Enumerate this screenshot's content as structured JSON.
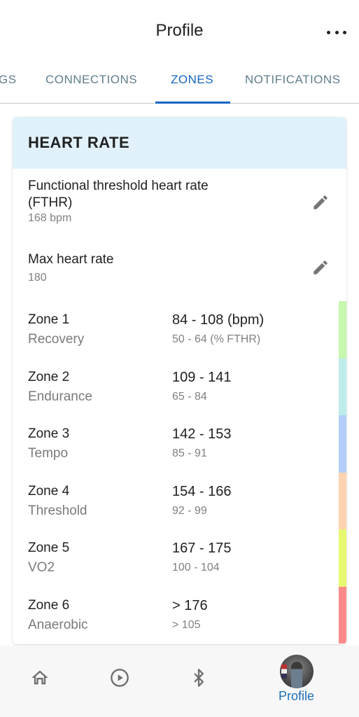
{
  "header": {
    "title": "Profile",
    "more_icon": "more-horizontal-icon"
  },
  "tabs": [
    {
      "label": "GS",
      "active": false
    },
    {
      "label": "CONNECTIONS",
      "active": false
    },
    {
      "label": "ZONES",
      "active": true
    },
    {
      "label": "NOTIFICATIONS",
      "active": false
    }
  ],
  "card": {
    "title": "HEART RATE",
    "settings": [
      {
        "label_line1": "Functional threshold heart rate",
        "label_line2": "(FTHR)",
        "value": "168 bpm",
        "icon": "edit-pencil-icon"
      },
      {
        "label_line1": "Max heart rate",
        "value": "180",
        "icon": "edit-pencil-icon"
      }
    ],
    "zones": [
      {
        "name": "Zone 1",
        "desc": "Recovery",
        "bpm": "84 - 108 (bpm)",
        "pct": "50 - 64 (% FTHR)",
        "color": "#c8f7b0"
      },
      {
        "name": "Zone 2",
        "desc": "Endurance",
        "bpm": "109 - 141",
        "pct": "65 - 84",
        "color": "#bdeceb"
      },
      {
        "name": "Zone 3",
        "desc": "Tempo",
        "bpm": "142 - 153",
        "pct": "85 - 91",
        "color": "#b3cffa"
      },
      {
        "name": "Zone 4",
        "desc": "Threshold",
        "bpm": "154 - 166",
        "pct": "92 - 99",
        "color": "#fed4b0"
      },
      {
        "name": "Zone 5",
        "desc": "VO2",
        "bpm": "167 - 175",
        "pct": "100 - 104",
        "color": "#e6f870"
      },
      {
        "name": "Zone 6",
        "desc": "Anaerobic",
        "bpm": "> 176",
        "pct": "> 105",
        "color": "#fd8a8a"
      }
    ]
  },
  "bottom_nav": [
    {
      "icon": "home-icon",
      "label": ""
    },
    {
      "icon": "play-circle-icon",
      "label": ""
    },
    {
      "icon": "bluetooth-icon",
      "label": ""
    },
    {
      "icon": "profile-avatar",
      "label": "Profile",
      "active": true
    }
  ],
  "colors": {
    "accent": "#1565c0",
    "header_bg": "#e1f1fc",
    "nav_bg": "#f7f7f7"
  }
}
